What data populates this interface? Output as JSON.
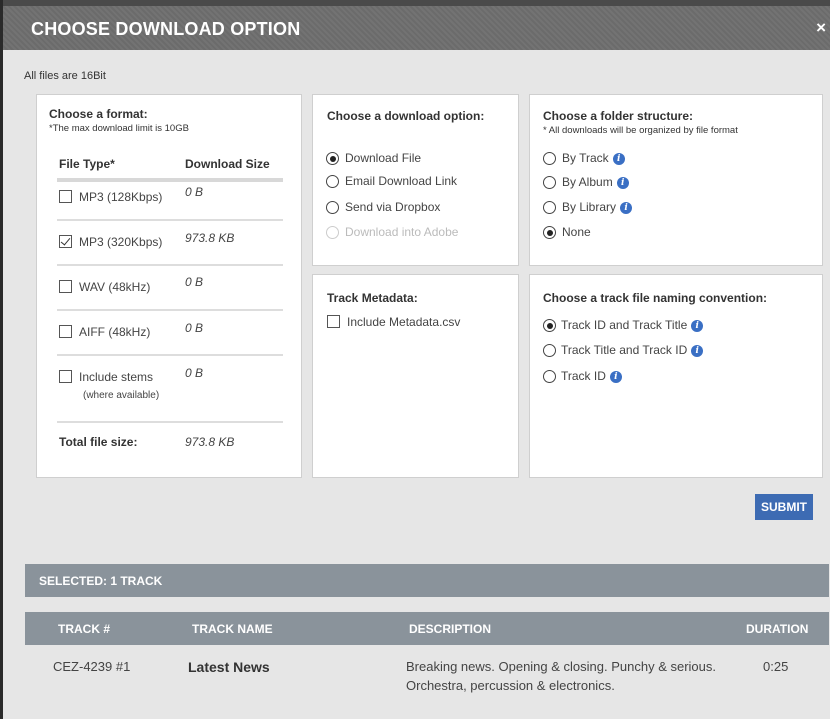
{
  "modal": {
    "title": "CHOOSE DOWNLOAD OPTION",
    "close_label": "×"
  },
  "note": "All files are 16Bit",
  "format": {
    "title": "Choose a format:",
    "subtitle": "*The max download limit is 10GB",
    "col_type": "File Type*",
    "col_size": "Download Size",
    "items": [
      {
        "label": "MP3 (128Kbps)",
        "size": "0 B",
        "checked": false
      },
      {
        "label": "MP3 (320Kbps)",
        "size": "973.8 KB",
        "checked": true
      },
      {
        "label": "WAV (48kHz)",
        "size": "0 B",
        "checked": false
      },
      {
        "label": "AIFF (48kHz)",
        "size": "0 B",
        "checked": false
      },
      {
        "label": "Include stems",
        "sublabel": "(where available)",
        "size": "0 B",
        "checked": false
      }
    ],
    "total_label": "Total file size:",
    "total_value": "973.8 KB"
  },
  "download_option": {
    "title": "Choose a download option:",
    "options": [
      {
        "label": "Download File",
        "selected": true,
        "disabled": false
      },
      {
        "label": "Email Download Link",
        "selected": false,
        "disabled": false
      },
      {
        "label": "Send via Dropbox",
        "selected": false,
        "disabled": false
      },
      {
        "label": "Download into Adobe",
        "selected": false,
        "disabled": true
      }
    ]
  },
  "folder": {
    "title": "Choose a folder structure:",
    "subtitle": "* All downloads will be organized by file format",
    "options": [
      {
        "label": "By Track",
        "selected": false,
        "info": true
      },
      {
        "label": "By Album",
        "selected": false,
        "info": true
      },
      {
        "label": "By Library",
        "selected": false,
        "info": true
      },
      {
        "label": "None",
        "selected": true,
        "info": false
      }
    ]
  },
  "metadata": {
    "title": "Track Metadata:",
    "checkbox_label": "Include Metadata.csv",
    "checked": false
  },
  "naming": {
    "title": "Choose a track file naming convention:",
    "options": [
      {
        "label": "Track ID and Track Title",
        "selected": true
      },
      {
        "label": "Track Title and Track ID",
        "selected": false
      },
      {
        "label": "Track ID",
        "selected": false
      }
    ]
  },
  "submit_label": "SUBMIT",
  "selected_label": "SELECTED: 1 TRACK",
  "table": {
    "headers": {
      "track": "TRACK #",
      "name": "TRACK NAME",
      "description": "DESCRIPTION",
      "duration": "DURATION"
    },
    "rows": [
      {
        "track": "CEZ-4239  #1",
        "name": "Latest News",
        "description": "Breaking news. Opening & closing. Punchy & serious. Orchestra, percussion & electronics.",
        "duration": "0:25"
      }
    ]
  },
  "colors": {
    "accent": "#3d6bb3",
    "header_bar": "#8a939b",
    "info_icon": "#3a6fc4"
  }
}
